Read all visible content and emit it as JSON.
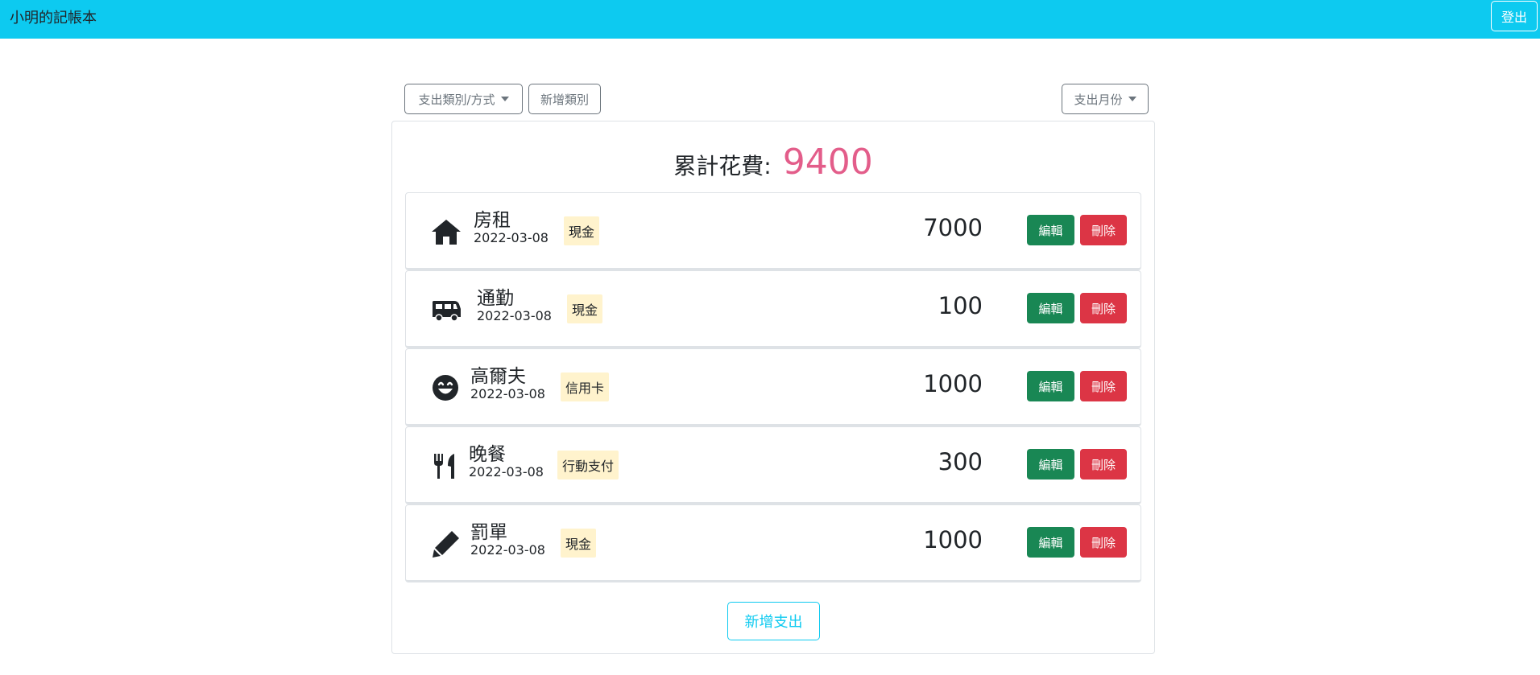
{
  "app": {
    "title": "小明的記帳本",
    "logout_label": "登出"
  },
  "toolbar": {
    "category_dropdown_label": "支出類別/方式",
    "add_category_label": "新增類別",
    "month_dropdown_label": "支出月份"
  },
  "summary": {
    "total_label": "累計花費:",
    "total_value": "9400",
    "total_color": "#e35d8a"
  },
  "expenses": [
    {
      "icon": "house-icon",
      "name": "房租",
      "date": "2022-03-08",
      "payment": "現金",
      "amount": "7000",
      "edit_label": "編輯",
      "delete_label": "刪除"
    },
    {
      "icon": "van-icon",
      "name": "通勤",
      "date": "2022-03-08",
      "payment": "現金",
      "amount": "100",
      "edit_label": "編輯",
      "delete_label": "刪除"
    },
    {
      "icon": "smile-icon",
      "name": "高爾夫",
      "date": "2022-03-08",
      "payment": "信用卡",
      "amount": "1000",
      "edit_label": "編輯",
      "delete_label": "刪除"
    },
    {
      "icon": "utensils-icon",
      "name": "晚餐",
      "date": "2022-03-08",
      "payment": "行動支付",
      "amount": "300",
      "edit_label": "編輯",
      "delete_label": "刪除"
    },
    {
      "icon": "pencil-icon",
      "name": "罰單",
      "date": "2022-03-08",
      "payment": "現金",
      "amount": "1000",
      "edit_label": "編輯",
      "delete_label": "刪除"
    }
  ],
  "add_expense_label": "新增支出",
  "colors": {
    "navbar": "#0dcaf0",
    "edit": "#198754",
    "delete": "#dc3545",
    "badge": "#fff3cd"
  }
}
